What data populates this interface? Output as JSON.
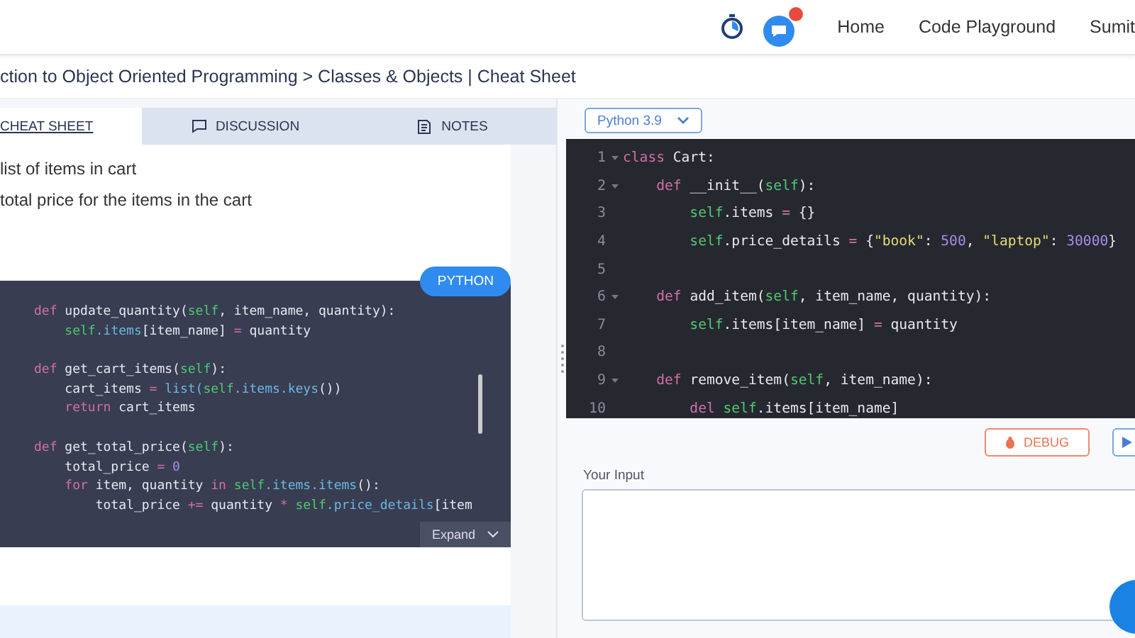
{
  "header": {
    "nav": [
      "Home",
      "Code Playground",
      "Sumit"
    ]
  },
  "breadcrumb": "ction to Object Oriented Programming > Classes & Objects | Cheat Sheet",
  "left_tabs": [
    {
      "label": "CHEAT SHEET",
      "selected": true
    },
    {
      "label": "DISCUSSION",
      "selected": false
    },
    {
      "label": "NOTES",
      "selected": false
    }
  ],
  "content_lines": [
    "list of items in cart",
    "total price for the items in the cart"
  ],
  "code_card": {
    "language": "PYTHON",
    "expand": "Expand",
    "lines": [
      {
        "tokens": [
          {
            "kind": "kw",
            "text": "def"
          },
          {
            "kind": "plain",
            "text": " update_quantity("
          },
          {
            "kind": "self",
            "text": "self"
          },
          {
            "kind": "plain",
            "text": ", item_name, quantity):"
          }
        ]
      },
      {
        "tokens": [
          {
            "kind": "self",
            "text": "    self"
          },
          {
            "kind": "attr",
            "text": ".items"
          },
          {
            "kind": "plain",
            "text": "[item_name] "
          },
          {
            "kind": "op",
            "text": "="
          },
          {
            "kind": "plain",
            "text": " quantity"
          }
        ]
      },
      {
        "gap_before": true,
        "tokens": [
          {
            "kind": "kw",
            "text": "def"
          },
          {
            "kind": "plain",
            "text": " get_cart_items("
          },
          {
            "kind": "self",
            "text": "self"
          },
          {
            "kind": "plain",
            "text": "):"
          }
        ]
      },
      {
        "tokens": [
          {
            "kind": "plain",
            "text": "    cart_items "
          },
          {
            "kind": "op",
            "text": "="
          },
          {
            "kind": "attr",
            "text": " list("
          },
          {
            "kind": "self",
            "text": "self"
          },
          {
            "kind": "attr",
            "text": ".items.keys"
          },
          {
            "kind": "plain",
            "text": "())"
          }
        ]
      },
      {
        "tokens": [
          {
            "kind": "kw",
            "text": "    return"
          },
          {
            "kind": "plain",
            "text": " cart_items"
          }
        ]
      },
      {
        "gap_before": true,
        "tokens": [
          {
            "kind": "kw",
            "text": "def"
          },
          {
            "kind": "plain",
            "text": " get_total_price("
          },
          {
            "kind": "self",
            "text": "self"
          },
          {
            "kind": "plain",
            "text": "):"
          }
        ]
      },
      {
        "tokens": [
          {
            "kind": "plain",
            "text": "    total_price "
          },
          {
            "kind": "op",
            "text": "="
          },
          {
            "kind": "num",
            "text": " 0"
          }
        ]
      },
      {
        "tokens": [
          {
            "kind": "kw",
            "text": "    for"
          },
          {
            "kind": "plain",
            "text": " item, quantity "
          },
          {
            "kind": "kw",
            "text": "in"
          },
          {
            "kind": "self",
            "text": " self"
          },
          {
            "kind": "attr",
            "text": ".items.items"
          },
          {
            "kind": "plain",
            "text": "():"
          }
        ]
      },
      {
        "tokens": [
          {
            "kind": "plain",
            "text": "        total_price "
          },
          {
            "kind": "op",
            "text": "+="
          },
          {
            "kind": "plain",
            "text": " quantity "
          },
          {
            "kind": "op",
            "text": "*"
          },
          {
            "kind": "self",
            "text": " self"
          },
          {
            "kind": "attr",
            "text": ".price_details"
          },
          {
            "kind": "plain",
            "text": "[item"
          }
        ]
      }
    ]
  },
  "editor": {
    "language": "Python 3.9",
    "lines": [
      {
        "number": "1",
        "foldable": true,
        "tokens": [
          {
            "kind": "kw",
            "text": "class"
          },
          {
            "kind": "plain",
            "text": " Cart:"
          }
        ]
      },
      {
        "number": "2",
        "foldable": true,
        "tokens": [
          {
            "kind": "kw",
            "text": "    def"
          },
          {
            "kind": "plain",
            "text": " __init__("
          },
          {
            "kind": "self",
            "text": "self"
          },
          {
            "kind": "plain",
            "text": "):"
          }
        ]
      },
      {
        "number": "3",
        "foldable": false,
        "tokens": [
          {
            "kind": "self",
            "text": "        self"
          },
          {
            "kind": "plain",
            "text": ".items "
          },
          {
            "kind": "op",
            "text": "="
          },
          {
            "kind": "plain",
            "text": " {}"
          }
        ]
      },
      {
        "number": "4",
        "foldable": false,
        "tokens": [
          {
            "kind": "self",
            "text": "        self"
          },
          {
            "kind": "plain",
            "text": ".price_details "
          },
          {
            "kind": "op",
            "text": "="
          },
          {
            "kind": "plain",
            "text": " {"
          },
          {
            "kind": "str",
            "text": "\"book\""
          },
          {
            "kind": "plain",
            "text": ": "
          },
          {
            "kind": "num",
            "text": "500"
          },
          {
            "kind": "plain",
            "text": ", "
          },
          {
            "kind": "str",
            "text": "\"laptop\""
          },
          {
            "kind": "plain",
            "text": ": "
          },
          {
            "kind": "num",
            "text": "30000"
          },
          {
            "kind": "plain",
            "text": "}"
          }
        ]
      },
      {
        "number": "5",
        "foldable": false
      },
      {
        "number": "6",
        "foldable": true,
        "tokens": [
          {
            "kind": "kw",
            "text": "    def"
          },
          {
            "kind": "plain",
            "text": " add_item("
          },
          {
            "kind": "self",
            "text": "self"
          },
          {
            "kind": "plain",
            "text": ", item_name, quantity):"
          }
        ]
      },
      {
        "number": "7",
        "foldable": false,
        "tokens": [
          {
            "kind": "self",
            "text": "        self"
          },
          {
            "kind": "plain",
            "text": ".items[item_name] "
          },
          {
            "kind": "op",
            "text": "="
          },
          {
            "kind": "plain",
            "text": " quantity"
          }
        ]
      },
      {
        "number": "8",
        "foldable": false
      },
      {
        "number": "9",
        "foldable": true,
        "tokens": [
          {
            "kind": "kw",
            "text": "    def"
          },
          {
            "kind": "plain",
            "text": " remove_item("
          },
          {
            "kind": "self",
            "text": "self"
          },
          {
            "kind": "plain",
            "text": ", item_name):"
          }
        ]
      },
      {
        "number": "10",
        "foldable": false,
        "tokens": [
          {
            "kind": "kw",
            "text": "        del"
          },
          {
            "kind": "self",
            "text": " self"
          },
          {
            "kind": "plain",
            "text": ".items[item_name]"
          }
        ]
      }
    ]
  },
  "debug_button": "DEBUG",
  "input": {
    "label": "Your Input"
  }
}
